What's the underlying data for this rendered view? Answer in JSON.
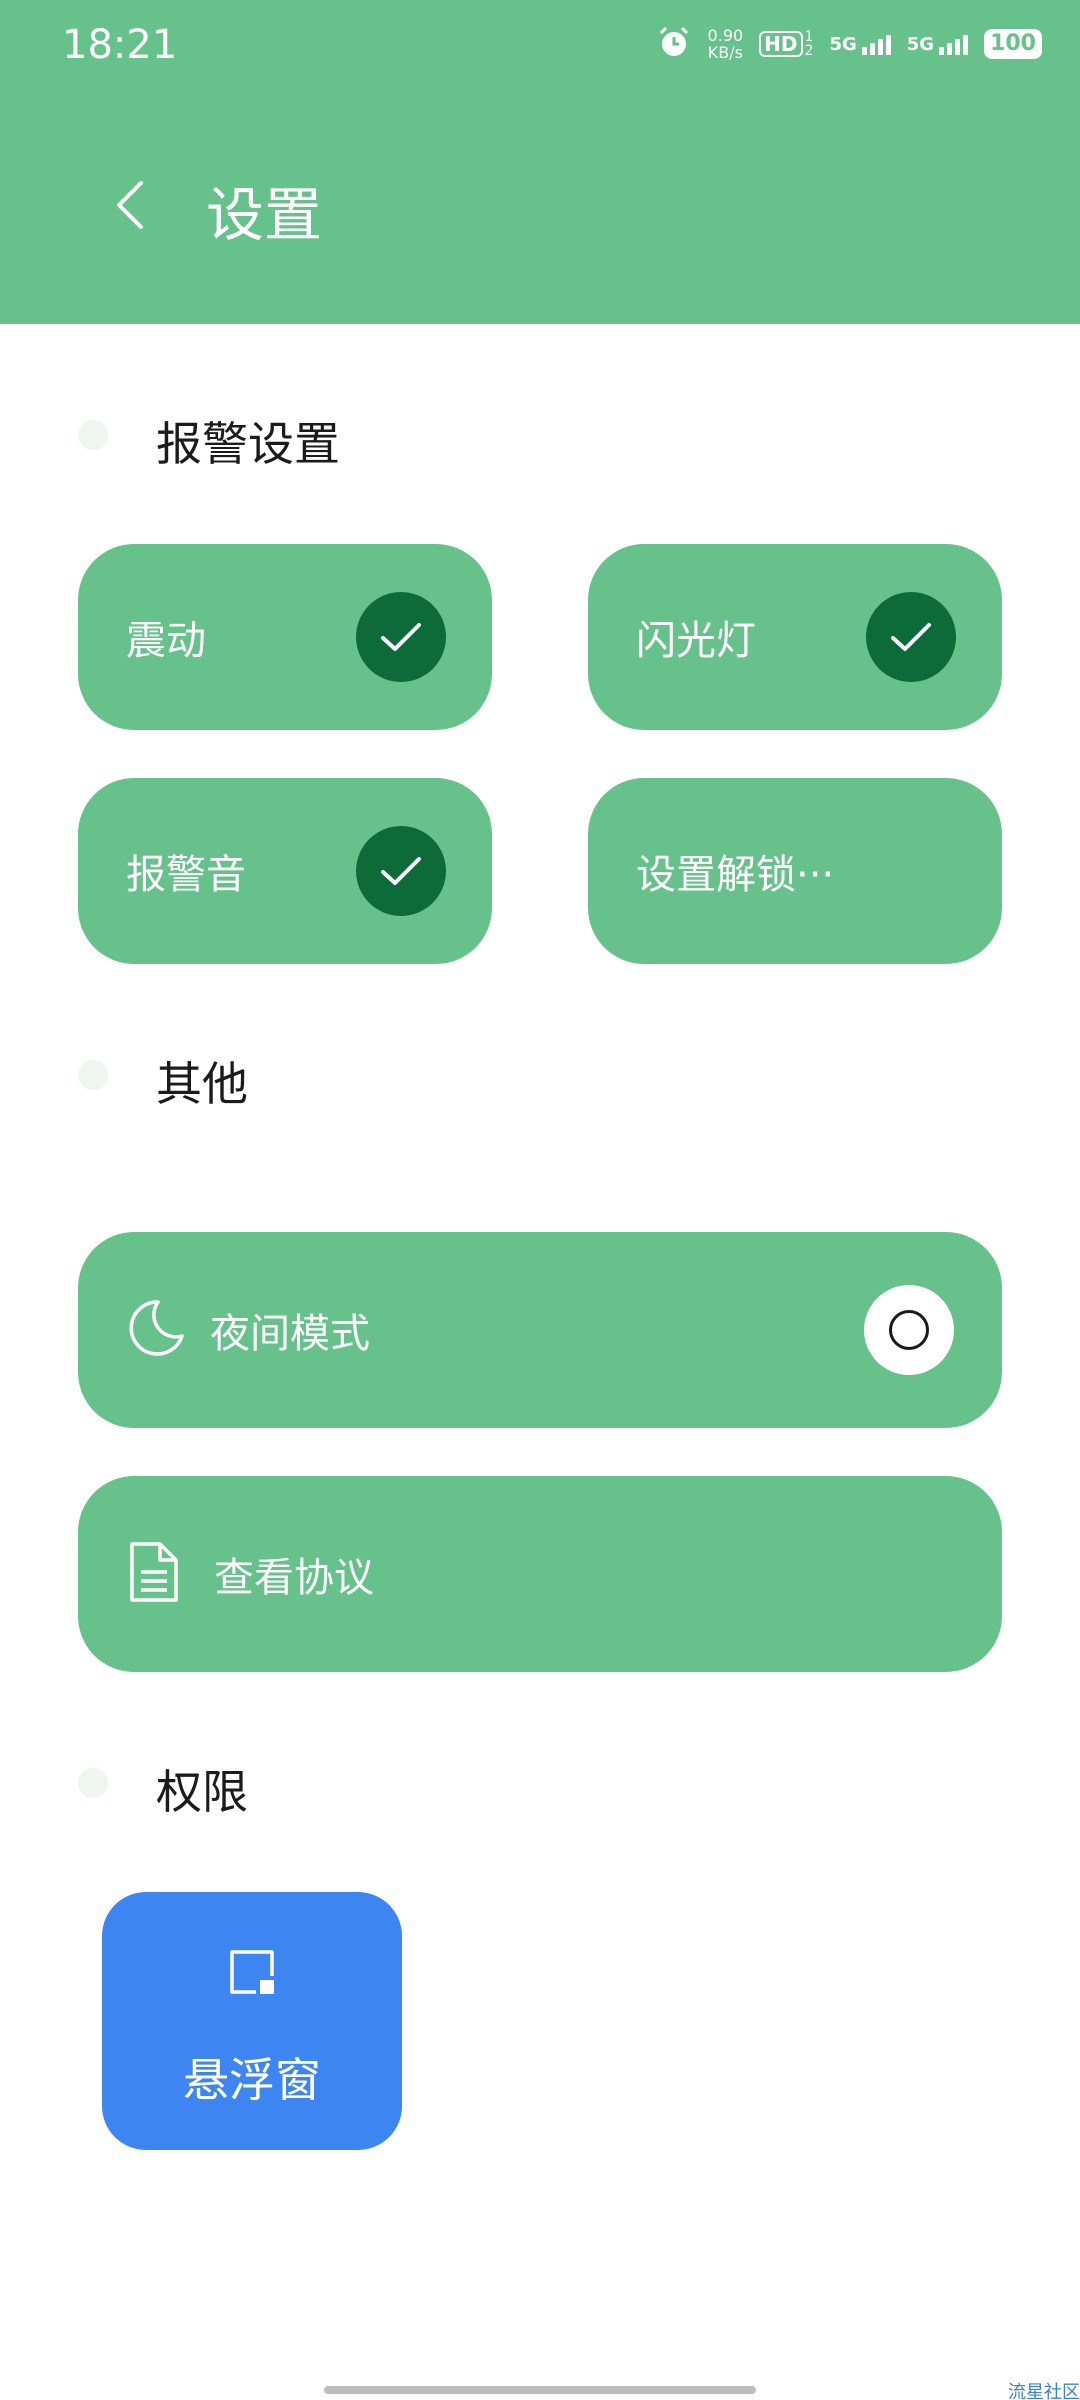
{
  "status_bar": {
    "time": "18:21",
    "net_speed_value": "0.90",
    "net_speed_unit": "KB/s",
    "hd_label": "HD",
    "sim1": "1",
    "sim2": "2",
    "signal1_label": "5G",
    "signal2_label": "5G",
    "battery": "100"
  },
  "header": {
    "title": "设置",
    "background_color": "#66c28a"
  },
  "sections": {
    "alarm": {
      "title": "报警设置",
      "tiles": [
        {
          "label": "震动",
          "checked": true
        },
        {
          "label": "闪光灯",
          "checked": true
        },
        {
          "label": "报警音",
          "checked": true
        },
        {
          "label": "设置解锁···",
          "checked": false
        }
      ]
    },
    "other": {
      "title": "其他",
      "night_mode": {
        "label": "夜间模式",
        "enabled": false,
        "icon": "moon-icon"
      },
      "agreement": {
        "label": "查看协议",
        "icon": "document-icon"
      }
    },
    "permission": {
      "title": "权限",
      "floating_window": {
        "label": "悬浮窗",
        "icon": "floating-window-icon",
        "color": "#3d86f2"
      }
    }
  },
  "watermark": "流星社区",
  "colors": {
    "accent": "#66c28a",
    "check_bg": "#0c6b38",
    "permission_card": "#3d86f2"
  }
}
